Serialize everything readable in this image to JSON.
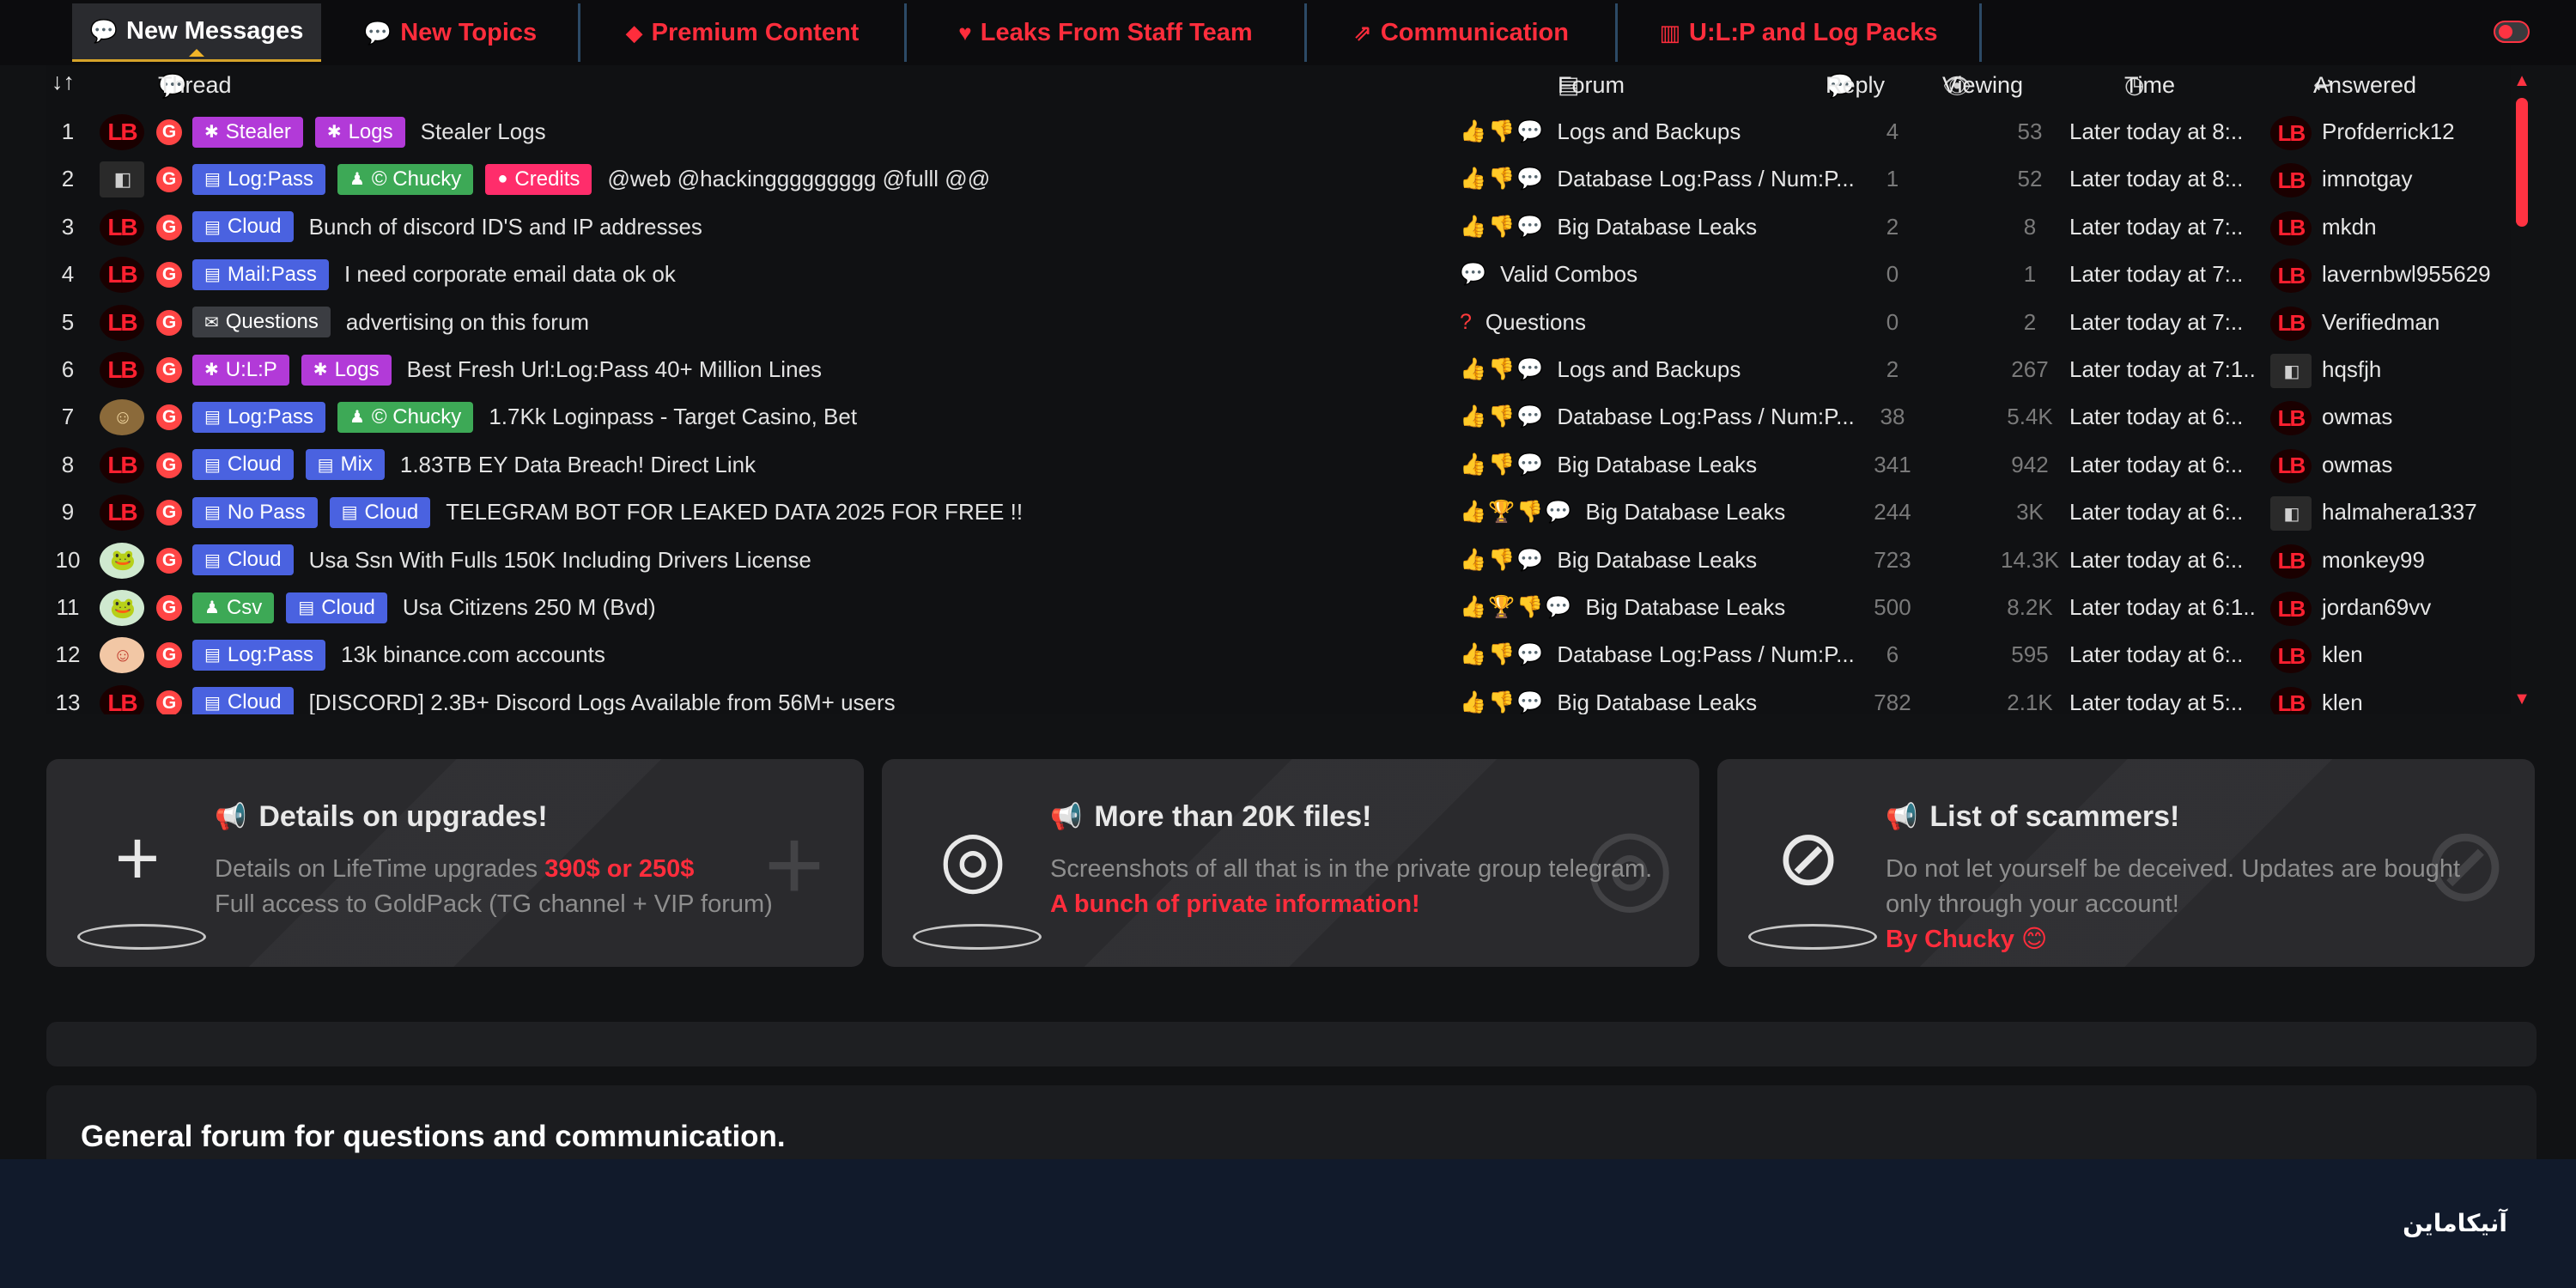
{
  "tabs": [
    {
      "label": "New Messages",
      "icon": "chat-bubble-icon",
      "glyph": "💬",
      "active": true
    },
    {
      "label": "New Topics",
      "icon": "chat-icon",
      "glyph": "💬",
      "active": false
    },
    {
      "label": "Premium Content",
      "icon": "gem-icon",
      "glyph": "◆",
      "active": false
    },
    {
      "label": "Leaks From Staff Team",
      "icon": "heart-gem-icon",
      "glyph": "♥",
      "active": false
    },
    {
      "label": "Communication",
      "icon": "share-icon",
      "glyph": "⇗",
      "active": false
    },
    {
      "label": "U:L:P and Log Packs",
      "icon": "chart-icon",
      "glyph": "▥",
      "active": false
    }
  ],
  "table": {
    "headers": {
      "sort": "↓↑",
      "thread": "Thread",
      "forum": "Forum",
      "reply": "Reply",
      "viewing": "Viewing",
      "time": "Time",
      "answered": "Answered"
    },
    "rows": [
      {
        "num": "1",
        "avatar": "LB",
        "prefixes": [
          {
            "label": "Stealer",
            "cls": "p-stealer",
            "glyph": "✱"
          },
          {
            "label": "Logs",
            "cls": "p-logs",
            "glyph": "✱"
          }
        ],
        "title": "Stealer Logs",
        "forum_icons": "👍👎💬",
        "forum": "Logs and Backups",
        "reply": "4",
        "viewing": "53",
        "time": "Later today at 8:..",
        "ans_avatar": "LB",
        "answered": "Profderrick12"
      },
      {
        "num": "2",
        "avatar": "◧",
        "avatar_cls": "img-broken",
        "prefixes": [
          {
            "label": "Log:Pass",
            "cls": "p-logpass",
            "glyph": "▤"
          },
          {
            "label": "© Chucky",
            "cls": "p-chucky",
            "glyph": "♟"
          },
          {
            "label": "Credits",
            "cls": "p-credits",
            "glyph": "●"
          }
        ],
        "title": "@web @hackinggggggggg @fulll @@",
        "forum_icons": "👍👎💬",
        "forum": "Database Log:Pass / Num:P...",
        "reply": "1",
        "viewing": "52",
        "time": "Later today at 8:..",
        "ans_avatar": "LB",
        "answered": "imnotgay"
      },
      {
        "num": "3",
        "avatar": "LB",
        "prefixes": [
          {
            "label": "Cloud",
            "cls": "p-cloud",
            "glyph": "▤"
          }
        ],
        "title": "Bunch of discord ID'S and IP addresses",
        "forum_icons": "👍👎💬",
        "forum": "Big Database Leaks",
        "reply": "2",
        "viewing": "8",
        "time": "Later today at 7:..",
        "ans_avatar": "LB",
        "answered": "mkdn"
      },
      {
        "num": "4",
        "avatar": "LB",
        "prefixes": [
          {
            "label": "Mail:Pass",
            "cls": "p-mailpass",
            "glyph": "▤"
          }
        ],
        "title": "I need corporate email data ok ok",
        "forum_icons": "💬",
        "forum": "Valid Combos",
        "reply": "0",
        "viewing": "1",
        "time": "Later today at 7:..",
        "ans_avatar": "LB",
        "answered": "lavernbwl955629"
      },
      {
        "num": "5",
        "avatar": "LB",
        "prefixes": [
          {
            "label": "Questions",
            "cls": "p-questions",
            "glyph": "✉"
          }
        ],
        "title": "advertising on this forum",
        "forum_icons": "?",
        "forum_icon_question": true,
        "forum": "Questions",
        "reply": "0",
        "viewing": "2",
        "time": "Later today at 7:..",
        "ans_avatar": "LB",
        "answered": "Verifiedman"
      },
      {
        "num": "6",
        "avatar": "LB",
        "prefixes": [
          {
            "label": "U:L:P",
            "cls": "p-ulp",
            "glyph": "✱"
          },
          {
            "label": "Logs",
            "cls": "p-logs",
            "glyph": "✱"
          }
        ],
        "title": "Best Fresh Url:Log:Pass 40+ Million Lines",
        "forum_icons": "👍👎💬",
        "forum": "Logs and Backups",
        "reply": "2",
        "viewing": "267",
        "time": "Later today at 7:1..",
        "ans_avatar": "◧",
        "ans_cls": "img-broken",
        "answered": "hqsfjh"
      },
      {
        "num": "7",
        "avatar": "☺",
        "avatar_cls": "img-face",
        "prefixes": [
          {
            "label": "Log:Pass",
            "cls": "p-logpass",
            "glyph": "▤"
          },
          {
            "label": "© Chucky",
            "cls": "p-chucky",
            "glyph": "♟"
          }
        ],
        "title": "1.7Kk Loginpass - Target Casino, Bet",
        "forum_icons": "👍👎💬",
        "forum": "Database Log:Pass / Num:P...",
        "reply": "38",
        "viewing": "5.4K",
        "time": "Later today at 6:..",
        "ans_avatar": "LB",
        "answered": "owmas"
      },
      {
        "num": "8",
        "avatar": "LB",
        "prefixes": [
          {
            "label": "Cloud",
            "cls": "p-cloud",
            "glyph": "▤"
          },
          {
            "label": "Mix",
            "cls": "p-mix",
            "glyph": "▤"
          }
        ],
        "title": "1.83TB EY Data Breach! Direct Link",
        "forum_icons": "👍👎💬",
        "forum": "Big Database Leaks",
        "reply": "341",
        "viewing": "942",
        "time": "Later today at 6:..",
        "ans_avatar": "LB",
        "answered": "owmas"
      },
      {
        "num": "9",
        "avatar": "LB",
        "prefixes": [
          {
            "label": "No Pass",
            "cls": "p-nopass",
            "glyph": "▤"
          },
          {
            "label": "Cloud",
            "cls": "p-cloud",
            "glyph": "▤"
          }
        ],
        "title": "TELEGRAM BOT FOR LEAKED DATA 2025 FOR FREE !!",
        "forum_icons": "👍🏆👎💬",
        "forum": "Big Database Leaks",
        "reply": "244",
        "viewing": "3K",
        "time": "Later today at 6:..",
        "ans_avatar": "◧",
        "ans_cls": "img-broken",
        "answered": "halmahera1337"
      },
      {
        "num": "10",
        "avatar": "🐸",
        "avatar_cls": "img-frog",
        "prefixes": [
          {
            "label": "Cloud",
            "cls": "p-cloud",
            "glyph": "▤"
          }
        ],
        "title": "Usa Ssn With Fulls 150K Including Drivers License",
        "forum_icons": "👍👎💬",
        "forum": "Big Database Leaks",
        "reply": "723",
        "viewing": "14.3K",
        "time": "Later today at 6:..",
        "ans_avatar": "LB",
        "answered": "monkey99"
      },
      {
        "num": "11",
        "avatar": "🐸",
        "avatar_cls": "img-frog",
        "prefixes": [
          {
            "label": "Csv",
            "cls": "p-csv",
            "glyph": "♟"
          },
          {
            "label": "Cloud",
            "cls": "p-cloud",
            "glyph": "▤"
          }
        ],
        "title": "Usa Citizens 250 M (Bvd)",
        "forum_icons": "👍🏆👎💬",
        "forum": "Big Database Leaks",
        "reply": "500",
        "viewing": "8.2K",
        "time": "Later today at 6:1..",
        "ans_avatar": "LB",
        "answered": "jordan69vv"
      },
      {
        "num": "12",
        "avatar": "☺",
        "avatar_cls": "img-anime",
        "prefixes": [
          {
            "label": "Log:Pass",
            "cls": "p-logpass",
            "glyph": "▤"
          }
        ],
        "title": "13k binance.com accounts",
        "forum_icons": "👍👎💬",
        "forum": "Database Log:Pass / Num:P...",
        "reply": "6",
        "viewing": "595",
        "time": "Later today at 6:..",
        "ans_avatar": "LB",
        "answered": "klen"
      },
      {
        "num": "13",
        "avatar": "LB",
        "prefixes": [
          {
            "label": "Cloud",
            "cls": "p-cloud",
            "glyph": "▤"
          }
        ],
        "title": "[DISCORD] 2.3B+ Discord Logs Available from 56M+ users",
        "forum_icons": "👍👎💬",
        "forum": "Big Database Leaks",
        "reply": "782",
        "viewing": "2.1K",
        "time": "Later today at 5:..",
        "ans_avatar": "LB",
        "answered": "klen"
      }
    ]
  },
  "cards": [
    {
      "title": "Details on upgrades!",
      "icon": "plus-icon",
      "glyph": "+",
      "line1_prefix": "Details on LifeTime upgrades ",
      "line1_highlight": "390$ or 250$",
      "line2": "Full access to GoldPack (TG channel + VIP forum)"
    },
    {
      "title": "More than 20K files!",
      "icon": "lifebuoy-icon",
      "glyph": "◎",
      "line1": "Screenshots of all that is in the private group telegram.",
      "highlight": "A bunch of private information!"
    },
    {
      "title": "List of scammers!",
      "icon": "ban-icon",
      "glyph": "⊘",
      "line1": "Do not let yourself be deceived. Updates are bought only through your account!",
      "highlight": "By Chucky 😊"
    }
  ],
  "section_title": "General forum for questions and communication.",
  "watermark": "آنیکاماین",
  "colors": {
    "accent": "#ff2d3c",
    "background": "#111214",
    "footer": "#111a2b"
  }
}
